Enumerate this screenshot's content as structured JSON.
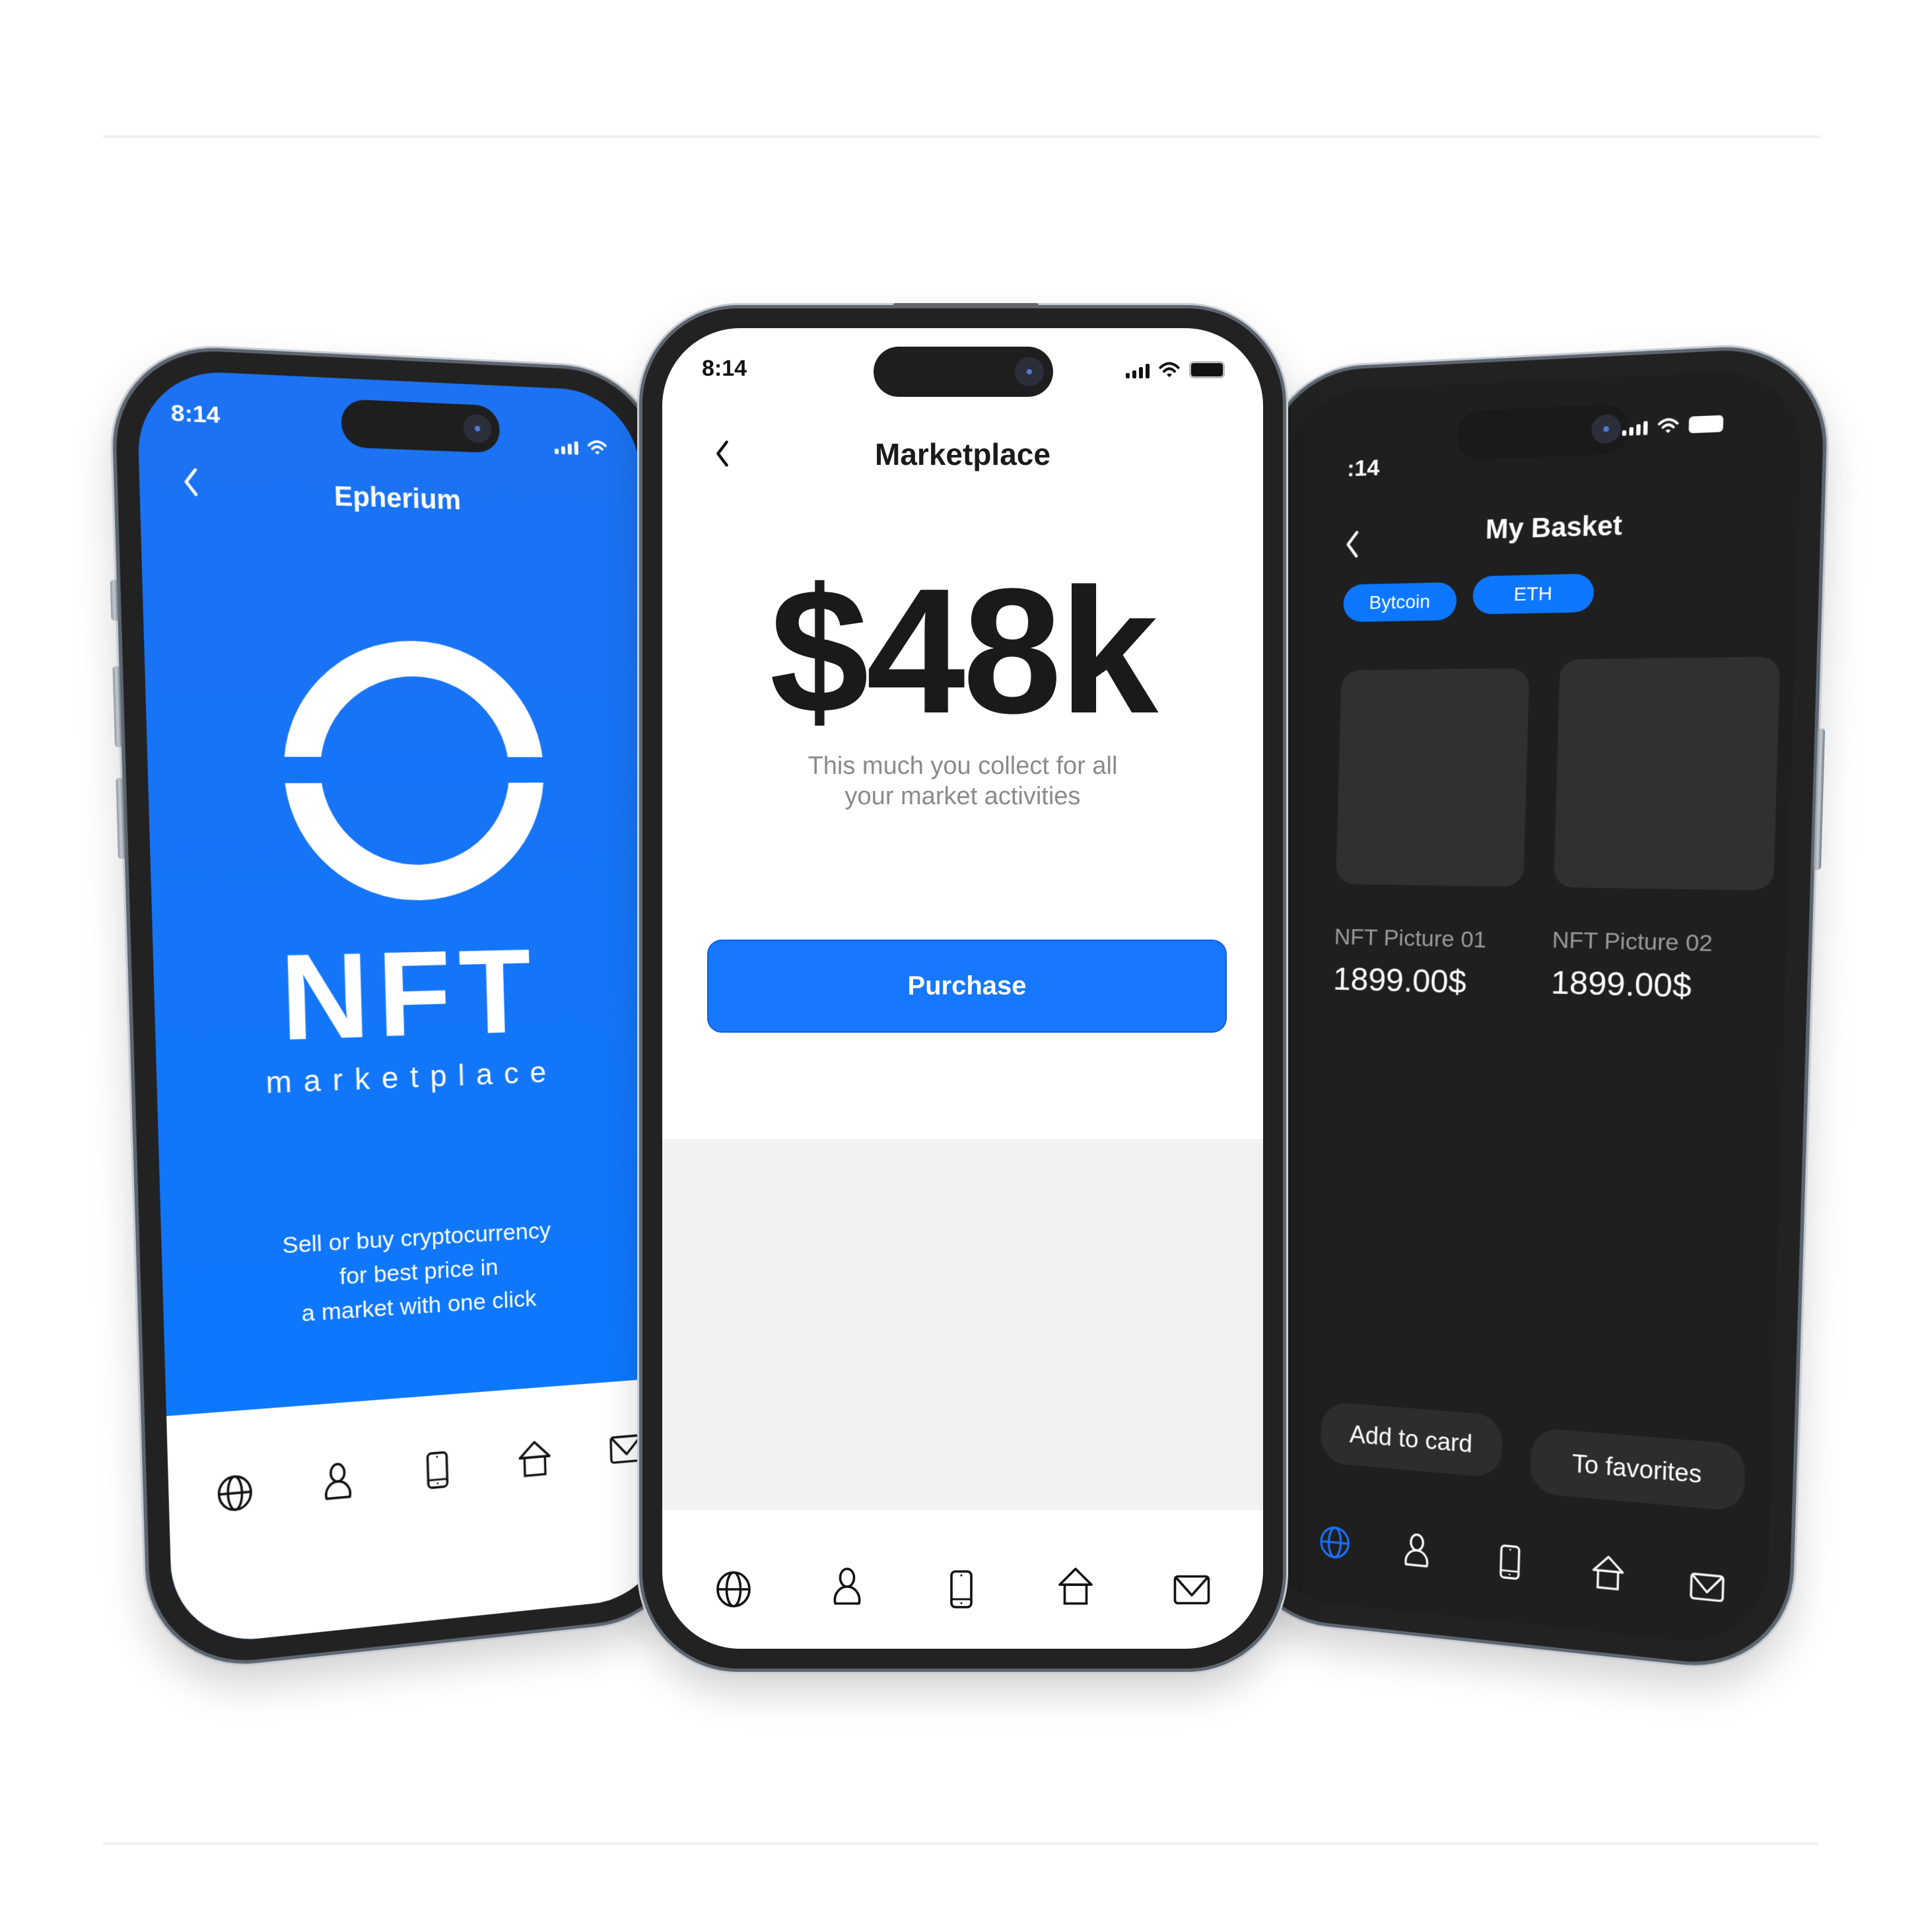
{
  "colors": {
    "brand_blue": "#0a79ff",
    "purchase_blue": "#1677ff",
    "dark_screen": "#1f1f1f",
    "tile": "#303030",
    "subtitle_gray": "#8a8a8a"
  },
  "left_phone": {
    "status_time": "8:14",
    "header_title": "Epherium",
    "logo_word": "NFT",
    "logo_sub": "marketplace",
    "description_lines": [
      "Sell or buy cryptocurrency",
      "for best price in",
      "a market with one click"
    ],
    "nav_icons": [
      "globe-icon",
      "user-icon",
      "phone-icon",
      "home-icon",
      "mail-icon"
    ]
  },
  "center_phone": {
    "status_time": "8:14",
    "header_title": "Marketplace",
    "amount": "$48k",
    "subtitle_lines": [
      "This much you collect for all",
      "your market activities"
    ],
    "purchase_label": "Purchase",
    "nav_icons": [
      "globe-icon",
      "user-icon",
      "phone-icon",
      "home-icon",
      "mail-icon"
    ]
  },
  "right_phone": {
    "status_time": ":14",
    "header_title": "My Basket",
    "chips": [
      {
        "label": "Bytcoin"
      },
      {
        "label": "ETH"
      }
    ],
    "items": [
      {
        "name": "NFT Picture 01",
        "price": "1899.00$"
      },
      {
        "name": "NFT Picture 02",
        "price": "1899.00$"
      }
    ],
    "add_to_card_label": "Add to card",
    "to_favorites_label": "To favorites",
    "nav_icons": [
      "globe-icon",
      "user-icon",
      "phone-icon",
      "home-icon",
      "mail-icon"
    ],
    "active_nav": "globe-icon"
  }
}
